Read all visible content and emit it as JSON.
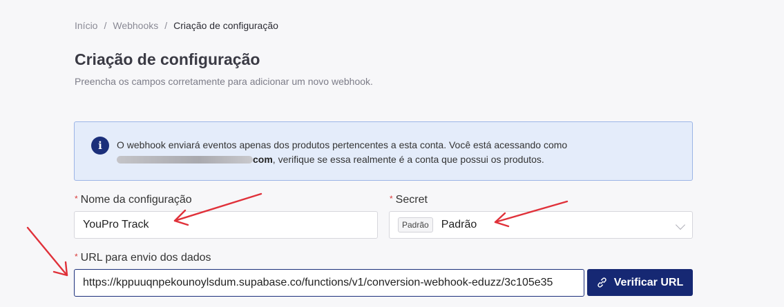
{
  "breadcrumb": {
    "home": "Início",
    "webhooks": "Webhooks",
    "current": "Criação de configuração",
    "separator": "/"
  },
  "header": {
    "title": "Criação de configuração",
    "subtitle": "Preencha os campos corretamente para adicionar um novo webhook."
  },
  "info": {
    "icon": "info-icon",
    "line1": "O webhook enviará eventos apenas dos produtos pertencentes a esta conta. Você está acessando como",
    "email_suffix": "com",
    "line2": ", verifique se essa realmente é a conta que possui os produtos."
  },
  "form": {
    "required_mark": "*",
    "name_label": "Nome da configuração",
    "name_value": "YouPro Track",
    "secret_label": "Secret",
    "secret_tag": "Padrão",
    "secret_value": "Padrão",
    "url_label": "URL para envio dos dados",
    "url_value": "https://kppuuqnpekounoylsdum.supabase.co/functions/v1/conversion-webhook-eduzz/3c105e35",
    "verify_label": "Verificar URL"
  },
  "colors": {
    "accent": "#162873",
    "annotation": "#e0313a",
    "info_bg": "#e4ecfa"
  }
}
